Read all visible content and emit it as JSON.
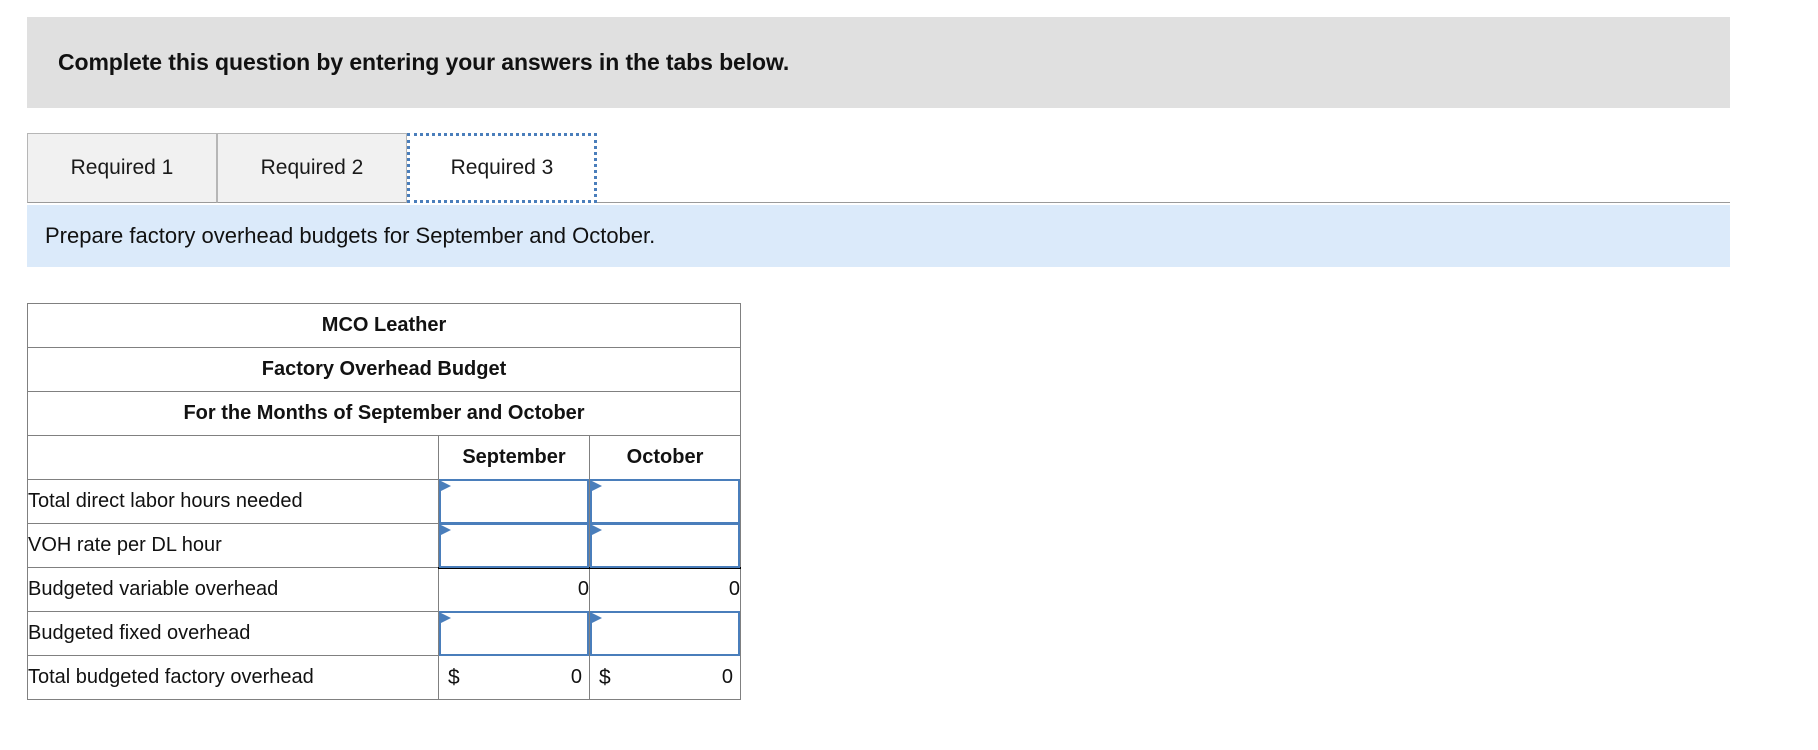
{
  "question_header": {
    "text": "Complete this question by entering your answers in the tabs below."
  },
  "tabs": [
    {
      "label": "Required 1",
      "active": false
    },
    {
      "label": "Required 2",
      "active": false
    },
    {
      "label": "Required 3",
      "active": true
    }
  ],
  "sub_instruction": {
    "text": "Prepare factory overhead budgets for September and October."
  },
  "worksheet": {
    "title_lines": [
      "MCO Leather",
      "Factory Overhead Budget",
      "For the Months of September and October"
    ],
    "column_headers": [
      "",
      "September",
      "October"
    ],
    "rows": [
      {
        "label": "Total direct labor hours needed",
        "kind": "input",
        "september": "",
        "october": "",
        "placeholder": ""
      },
      {
        "label": "VOH rate per DL hour",
        "kind": "input",
        "september": "",
        "october": "",
        "placeholder": ""
      },
      {
        "label": "Budgeted variable overhead",
        "kind": "computed",
        "september": "0",
        "october": "0"
      },
      {
        "label": "Budgeted fixed overhead",
        "kind": "input",
        "september": "",
        "october": "",
        "placeholder": ""
      },
      {
        "label": "Total budgeted factory overhead",
        "kind": "total",
        "september_symbol": "$",
        "september": "0",
        "october_symbol": "$",
        "october": "0"
      }
    ]
  },
  "colors": {
    "header_gray": "#e0e0e0",
    "instruction_blue": "#dbeafa",
    "table_header_blue": "#85aade",
    "input_border_blue": "#4a7ebb",
    "grid_gray": "#808080"
  }
}
